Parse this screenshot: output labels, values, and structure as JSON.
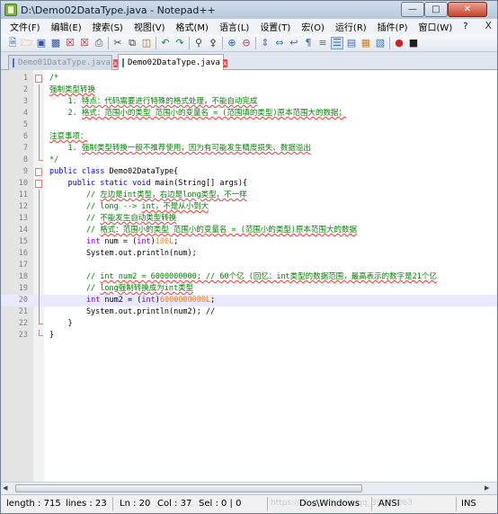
{
  "window": {
    "title": "D:\\Demo02DataType.java - Notepad++"
  },
  "menu": [
    "文件(F)",
    "编辑(E)",
    "搜索(S)",
    "视图(V)",
    "格式(M)",
    "语言(L)",
    "设置(T)",
    "宏(O)",
    "运行(R)",
    "插件(P)",
    "窗口(W)",
    "?"
  ],
  "menu_close": "X",
  "tabs": [
    {
      "label": "Demo01DataType.java",
      "active": false
    },
    {
      "label": "Demo02DataType.java",
      "active": true
    }
  ],
  "editor": {
    "current_line": 20,
    "lines": [
      {
        "n": "1",
        "fold": "box",
        "tokens": [
          {
            "t": "/*",
            "c": "cmt"
          }
        ]
      },
      {
        "n": "2",
        "fold": "vline",
        "tokens": [
          {
            "t": "强制类型转换",
            "c": "cmt",
            "sq": true
          }
        ]
      },
      {
        "n": "3",
        "fold": "vline",
        "tokens": [
          {
            "t": "    1. ",
            "c": "cmt"
          },
          {
            "t": "特点：代码需要进行特殊的格式处理，不能自动完成",
            "c": "cmt",
            "sq": true
          }
        ]
      },
      {
        "n": "4",
        "fold": "vline",
        "tokens": [
          {
            "t": "    2. ",
            "c": "cmt"
          },
          {
            "t": "格式：范围小的类型 范围小的变量名 = (范围填的类型)原本范围大的数据；",
            "c": "cmt",
            "sq": true
          }
        ]
      },
      {
        "n": "5",
        "fold": "vline",
        "tokens": []
      },
      {
        "n": "6",
        "fold": "vline",
        "tokens": [
          {
            "t": "注意事项：",
            "c": "cmt",
            "sq": true
          }
        ]
      },
      {
        "n": "7",
        "fold": "vline",
        "tokens": [
          {
            "t": "    1. ",
            "c": "cmt"
          },
          {
            "t": "强制类型转换一般不推荐使用，因为有可能发生精度损失、数据溢出",
            "c": "cmt",
            "sq": true
          }
        ]
      },
      {
        "n": "8",
        "fold": "end",
        "tokens": [
          {
            "t": "*/",
            "c": "cmt"
          }
        ]
      },
      {
        "n": "9",
        "fold": "box",
        "tokens": [
          {
            "t": "public class ",
            "c": "kw"
          },
          {
            "t": "Demo02DataType{",
            "c": "plain"
          }
        ]
      },
      {
        "n": "10",
        "fold": "box",
        "tokens": [
          {
            "t": "    public static void ",
            "c": "kw"
          },
          {
            "t": "main(String[] args){",
            "c": "plain"
          }
        ]
      },
      {
        "n": "11",
        "fold": "vline",
        "tokens": [
          {
            "t": "        // ",
            "c": "cmt"
          },
          {
            "t": "左边是int类型，右边是long类型，不一样",
            "c": "cmt",
            "sq": true
          }
        ]
      },
      {
        "n": "12",
        "fold": "vline",
        "tokens": [
          {
            "t": "        // long --> ",
            "c": "cmt"
          },
          {
            "t": "int，不是从小到大",
            "c": "cmt",
            "sq": true
          }
        ]
      },
      {
        "n": "13",
        "fold": "vline",
        "tokens": [
          {
            "t": "        // ",
            "c": "cmt"
          },
          {
            "t": "不能发生自动类型转换",
            "c": "cmt",
            "sq": true
          }
        ]
      },
      {
        "n": "14",
        "fold": "vline",
        "tokens": [
          {
            "t": "        // ",
            "c": "cmt"
          },
          {
            "t": "格式：范围小的类型 范围小的变量名 = (范围小的类型)原本范围大的数据",
            "c": "cmt",
            "sq": true
          }
        ]
      },
      {
        "n": "15",
        "fold": "vline",
        "tokens": [
          {
            "t": "        ",
            "c": "plain"
          },
          {
            "t": "int",
            "c": "type"
          },
          {
            "t": " num = (",
            "c": "plain"
          },
          {
            "t": "int",
            "c": "type"
          },
          {
            "t": ")",
            "c": "plain"
          },
          {
            "t": "100L",
            "c": "num"
          },
          {
            "t": ";",
            "c": "plain"
          }
        ]
      },
      {
        "n": "16",
        "fold": "vline",
        "tokens": [
          {
            "t": "        System.out.println(num);",
            "c": "plain"
          }
        ]
      },
      {
        "n": "17",
        "fold": "vline",
        "tokens": []
      },
      {
        "n": "18",
        "fold": "vline",
        "tokens": [
          {
            "t": "        // ",
            "c": "cmt"
          },
          {
            "t": "int num2 = 6000000000; // 60个亿 (回忆：int类型的数据范围，最高表示的数字是21个亿",
            "c": "cmt",
            "sq": true
          }
        ]
      },
      {
        "n": "19",
        "fold": "vline",
        "tokens": [
          {
            "t": "        // ",
            "c": "cmt"
          },
          {
            "t": "long强制转换成为int类型",
            "c": "cmt",
            "sq": true
          }
        ]
      },
      {
        "n": "20",
        "fold": "vline",
        "tokens": [
          {
            "t": "        ",
            "c": "plain"
          },
          {
            "t": "int",
            "c": "type"
          },
          {
            "t": " num2 = (",
            "c": "plain"
          },
          {
            "t": "int",
            "c": "type"
          },
          {
            "t": ")",
            "c": "plain"
          },
          {
            "t": "6000000000L",
            "c": "num"
          },
          {
            "t": ";",
            "c": "plain"
          }
        ]
      },
      {
        "n": "21",
        "fold": "vline",
        "tokens": [
          {
            "t": "        System.out.println(num2); //",
            "c": "plain"
          }
        ]
      },
      {
        "n": "22",
        "fold": "end",
        "tokens": [
          {
            "t": "    }",
            "c": "plain"
          }
        ]
      },
      {
        "n": "23",
        "fold": "end",
        "tokens": [
          {
            "t": "}",
            "c": "plain"
          }
        ]
      }
    ]
  },
  "status": {
    "length": "length : 715",
    "lines": "lines : 23",
    "ln": "Ln : 20",
    "col": "Col : 37",
    "sel": "Sel : 0 | 0",
    "eol": "Dos\\Windows",
    "encoding": "ANSI",
    "mode": "INS",
    "watermark": "https://blog.csdn.net/qq_39277063"
  },
  "colors": {
    "comment": "#008000",
    "keyword": "#0000ff",
    "type": "#8000ff",
    "number": "#ff8000",
    "current_line": "#e8e8ff"
  }
}
